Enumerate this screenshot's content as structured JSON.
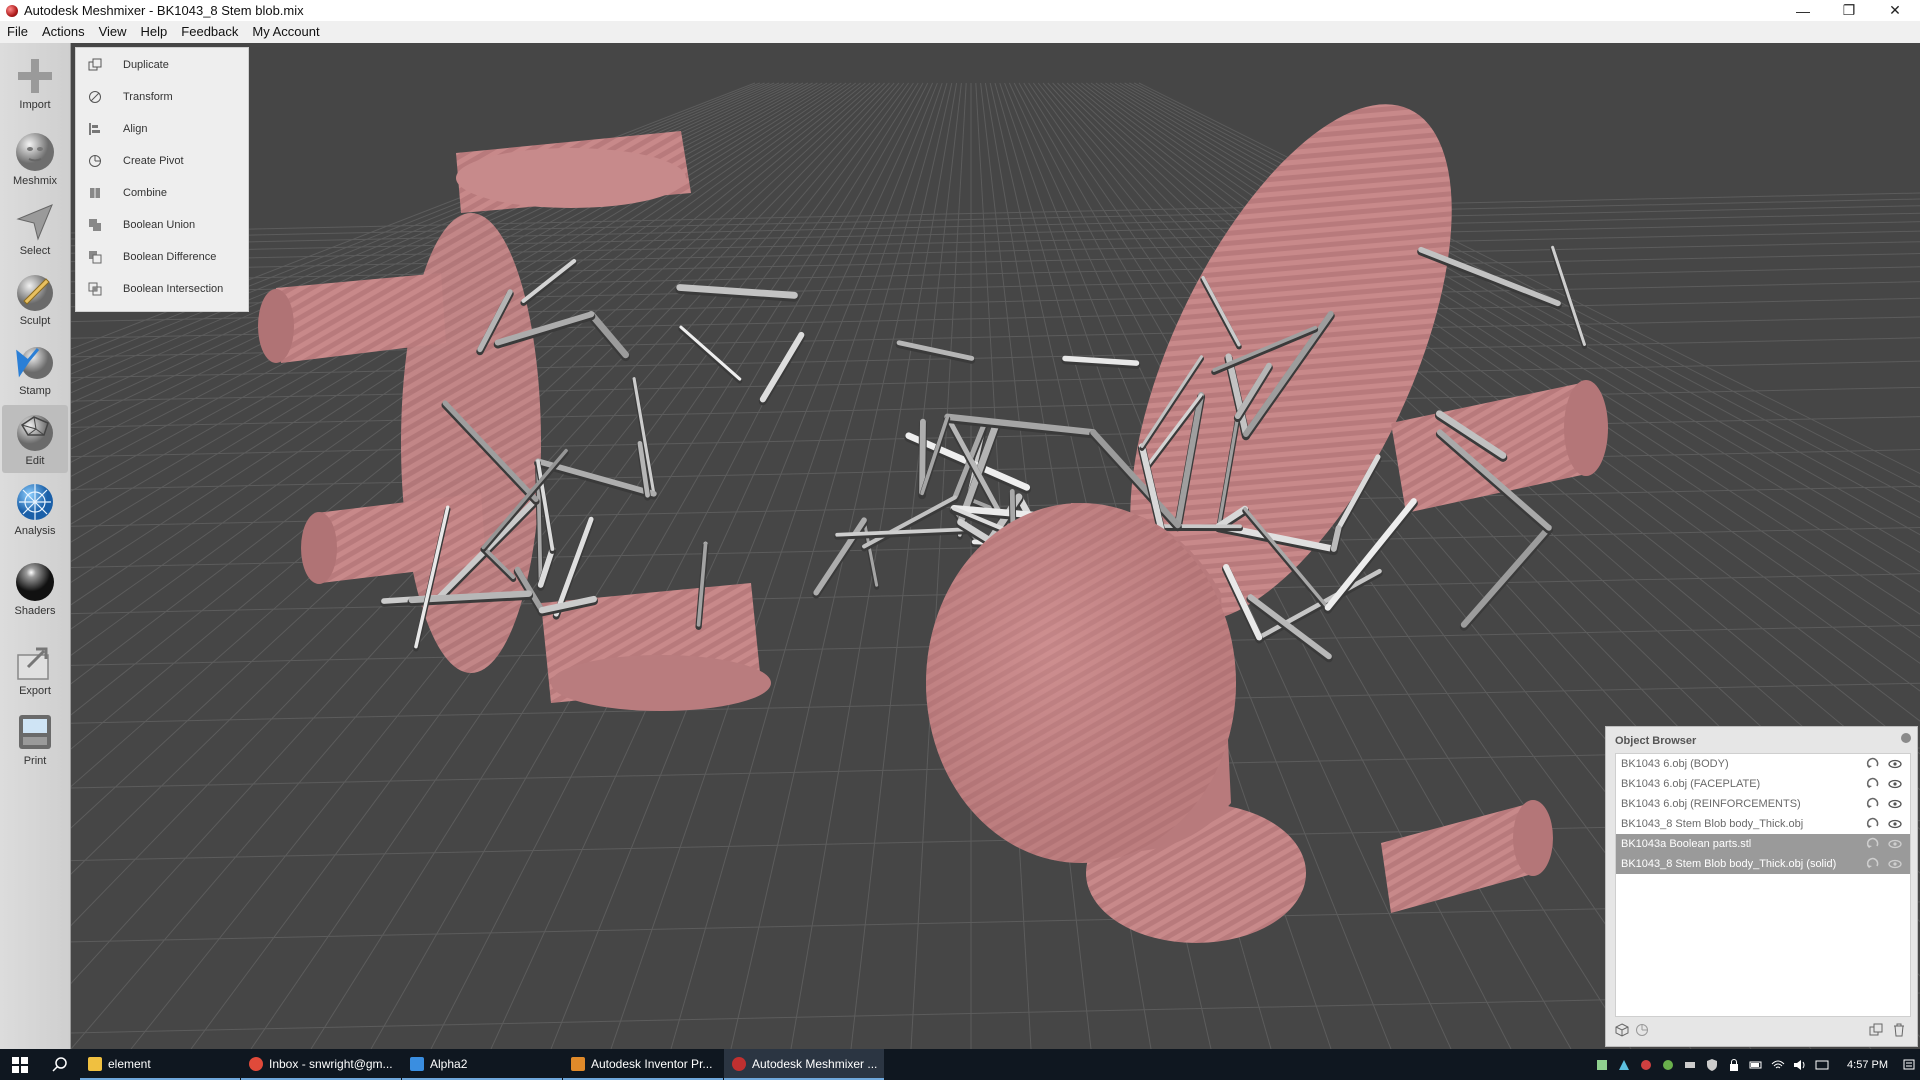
{
  "window": {
    "title": "Autodesk Meshmixer - BK1043_8 Stem blob.mix"
  },
  "menu": [
    "File",
    "Actions",
    "View",
    "Help",
    "Feedback",
    "My Account"
  ],
  "tools": [
    {
      "label": "Import",
      "icon": "plus-icon"
    },
    {
      "label": "Meshmix",
      "icon": "face-sphere-icon"
    },
    {
      "label": "Select",
      "icon": "arrow-select-icon"
    },
    {
      "label": "Sculpt",
      "icon": "brush-icon"
    },
    {
      "label": "Stamp",
      "icon": "stamp-icon"
    },
    {
      "label": "Edit",
      "icon": "edit-mesh-icon",
      "active": true
    },
    {
      "label": "Analysis",
      "icon": "analysis-icon"
    },
    {
      "label": "Shaders",
      "icon": "sphere-shader-icon"
    },
    {
      "label": "Export",
      "icon": "export-icon"
    },
    {
      "label": "Print",
      "icon": "printer-icon"
    }
  ],
  "actions_menu": [
    {
      "label": "Duplicate",
      "icon": "duplicate-icon"
    },
    {
      "label": "Transform",
      "icon": "transform-icon"
    },
    {
      "label": "Align",
      "icon": "align-icon"
    },
    {
      "label": "Create Pivot",
      "icon": "pivot-icon"
    },
    {
      "label": "Combine",
      "icon": "combine-icon"
    },
    {
      "label": "Boolean Union",
      "icon": "boolean-union-icon"
    },
    {
      "label": "Boolean Difference",
      "icon": "boolean-difference-icon"
    },
    {
      "label": "Boolean Intersection",
      "icon": "boolean-intersection-icon"
    }
  ],
  "object_browser": {
    "title": "Object Browser",
    "objects": [
      {
        "name": "BK1043 6.obj (BODY)",
        "selected": false
      },
      {
        "name": "BK1043 6.obj (FACEPLATE)",
        "selected": false
      },
      {
        "name": "BK1043 6.obj (REINFORCEMENTS)",
        "selected": false
      },
      {
        "name": "BK1043_8 Stem Blob body_Thick.obj",
        "selected": false
      },
      {
        "name": "BK1043a Boolean parts.stl",
        "selected": true
      },
      {
        "name": "BK1043_8 Stem Blob body_Thick.obj (solid)",
        "selected": true
      }
    ]
  },
  "taskbar": {
    "apps": [
      {
        "label": "element",
        "icon": "folder-icon",
        "color": "#f0c040",
        "active": false
      },
      {
        "label": "Inbox - snwright@gm...",
        "icon": "chrome-icon",
        "color": "#e04a3a",
        "active": false
      },
      {
        "label": "Alpha2",
        "icon": "alpha2-icon",
        "color": "#3a8ee0",
        "active": false
      },
      {
        "label": "Autodesk Inventor Pr...",
        "icon": "inventor-icon",
        "color": "#e08a2a",
        "active": false
      },
      {
        "label": "Autodesk Meshmixer ...",
        "icon": "meshmixer-icon",
        "color": "#c03030",
        "active": true
      }
    ],
    "time": "4:57 PM"
  },
  "colors": {
    "viewport": "#464646",
    "model_pink": "#c8898a",
    "lattice": "#bdbdbd",
    "selection": "#9a9a9a"
  }
}
